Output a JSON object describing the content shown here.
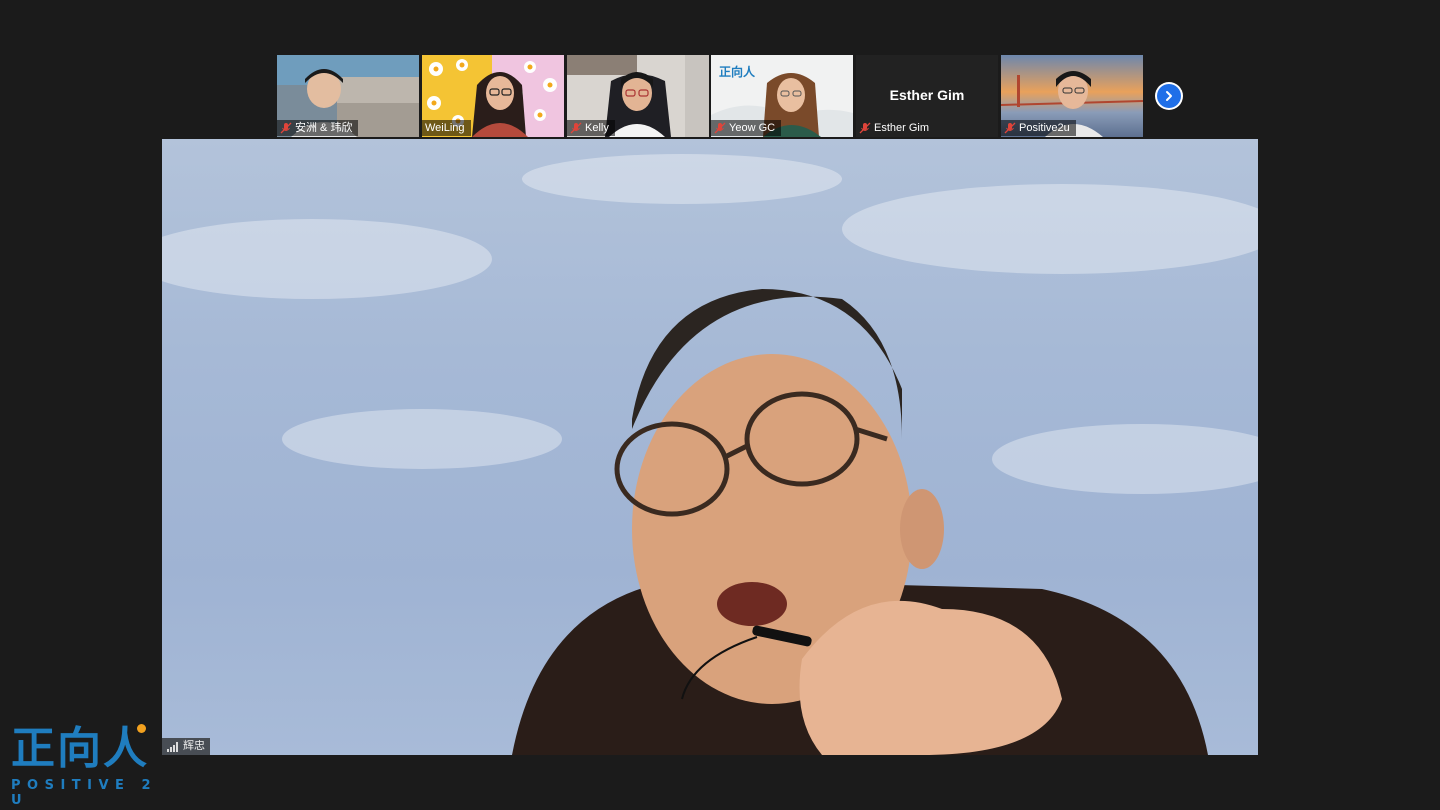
{
  "meeting": {
    "participants": [
      {
        "name": "安洲 & 玮欣",
        "muted": true
      },
      {
        "name": "WeiLing",
        "muted": false
      },
      {
        "name": "Kelly",
        "muted": true
      },
      {
        "name": "Yeow GC",
        "muted": true,
        "tile_logo_text": "正向人"
      },
      {
        "name": "Esther Gim",
        "muted": true,
        "camera_off": true,
        "display_name": "Esther Gim"
      },
      {
        "name": "Positive2u",
        "muted": true
      }
    ],
    "next_page_icon": "chevron-right-icon",
    "active_speaker": {
      "name": "辉忠",
      "signal_icon": "signal-bars-icon"
    }
  },
  "branding": {
    "logo_cn": "正向人",
    "logo_en": "POSITIVE 2 U",
    "accent": "#1f7dbf",
    "dot_color": "#f2a11f"
  },
  "colors": {
    "background": "#1b1b1b",
    "nav_button": "#1f6fe8",
    "muted_icon": "#e0443a"
  }
}
